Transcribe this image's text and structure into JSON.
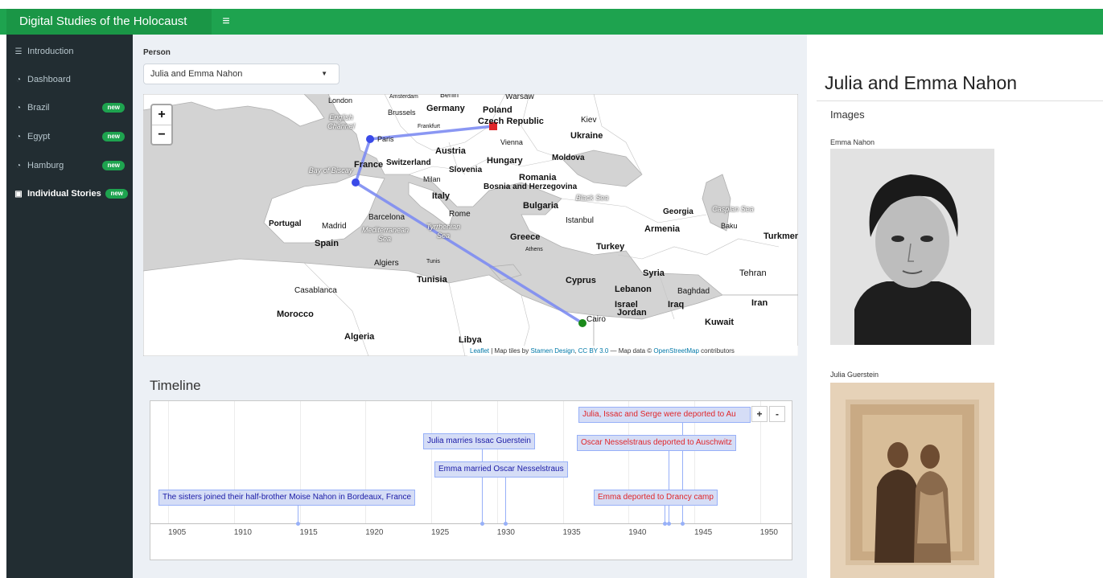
{
  "header": {
    "title": "Digital Studies of the Holocaust",
    "menu_icon": "hamburger-icon"
  },
  "sidebar": {
    "items": [
      {
        "label": "Introduction",
        "icon": "list-icon",
        "badge": ""
      },
      {
        "label": "Dashboard",
        "icon": "dashboard-icon",
        "badge": ""
      },
      {
        "label": "Brazil",
        "icon": "dashboard-icon",
        "badge": "new"
      },
      {
        "label": "Egypt",
        "icon": "dashboard-icon",
        "badge": "new"
      },
      {
        "label": "Hamburg",
        "icon": "dashboard-icon",
        "badge": "new"
      },
      {
        "label": "Individual Stories",
        "icon": "user-box-icon",
        "badge": "new"
      }
    ]
  },
  "person": {
    "label": "Person",
    "selected": "Julia and Emma Nahon"
  },
  "map": {
    "zoom_in": "+",
    "zoom_out": "−",
    "labels": [
      "London",
      "Amsterdam",
      "Berlin",
      "Warsaw",
      "Brussels",
      "Germany",
      "Poland",
      "English Channel",
      "Frankfurt",
      "Czech Republic",
      "Kiev",
      "Paris",
      "Ukraine",
      "Vienna",
      "Austria",
      "Moldova",
      "Bay of Biscay",
      "France",
      "Switzerland",
      "Hungary",
      "Milan",
      "Slovenia",
      "Romania",
      "Bosnia and Herzegovina",
      "Italy",
      "Black Sea",
      "Bulgaria",
      "Caspian Sea",
      "Barcelona",
      "Rome",
      "Georgia",
      "Portugal",
      "Madrid",
      "Tyrrhenian Sea",
      "Mediterranean Sea",
      "Istanbul",
      "Baku",
      "Spain",
      "Greece",
      "Armenia",
      "Turkmen",
      "Turkey",
      "Athens",
      "Algiers",
      "Tunis",
      "Syria",
      "Tehran",
      "Tunisia",
      "Cyprus",
      "Lebanon",
      "Baghdad",
      "Casablanca",
      "Israel",
      "Iraq",
      "Iran",
      "Jordan",
      "Morocco",
      "Cairo",
      "Kuwait",
      "Algeria",
      "Libya"
    ],
    "attribution": {
      "leaflet": "Leaflet",
      "tiles_prefix": " | Map tiles by ",
      "stamen": "Stamen Design",
      "comma": ", ",
      "license": "CC BY 3.0",
      "data_prefix": " — Map data © ",
      "osm": "OpenStreetMap",
      "suffix": " contributors"
    },
    "colors": {
      "route": "#7d8cf2",
      "start": "#1a8a1a",
      "end": "#e0262a",
      "stop": "#3a4ae8"
    }
  },
  "timeline": {
    "title": "Timeline",
    "years": [
      "1905",
      "1910",
      "1915",
      "1920",
      "1925",
      "1930",
      "1935",
      "1940",
      "1945",
      "1950"
    ],
    "events": [
      {
        "text": "The sisters joined their half-brother Moise Nahon in Bordeaux, France",
        "year": 1914.0,
        "color": "blue"
      },
      {
        "text": "Julia marries Issac Guerstein",
        "year": 1928.0,
        "color": "blue"
      },
      {
        "text": "Emma married Oscar Nesselstraus",
        "year": 1929.8,
        "color": "blue"
      },
      {
        "text": "Julia, Issac and Serge were deported to Au",
        "year": 1943.2,
        "color": "red"
      },
      {
        "text": "Oscar Nesselstraus deported to Auschwitz",
        "year": 1942.2,
        "color": "red"
      },
      {
        "text": "Emma deported to Drancy camp",
        "year": 1941.9,
        "color": "red"
      }
    ],
    "zoom_in": "+",
    "zoom_out": "-"
  },
  "panel": {
    "title": "Julia and Emma Nahon",
    "images_heading": "Images",
    "images": [
      {
        "caption": "Emma Nahon"
      },
      {
        "caption": "Julia Guerstein"
      }
    ]
  }
}
